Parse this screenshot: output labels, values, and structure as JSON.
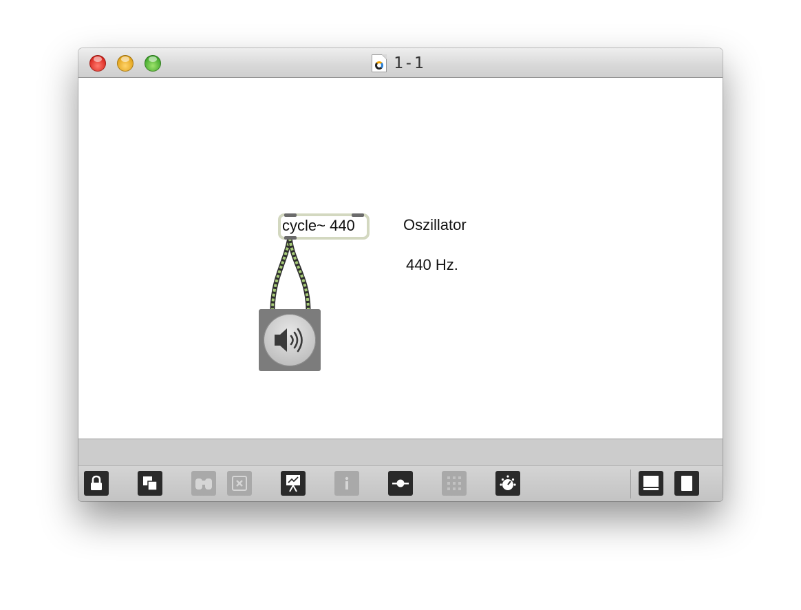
{
  "window": {
    "title": "1-1",
    "title_icon": "maxpat-document-icon",
    "traffic_lights": [
      "close",
      "minimize",
      "zoom"
    ]
  },
  "patch": {
    "object": {
      "text": "cycle~ 440",
      "inlets": 2,
      "outlets": 1
    },
    "comments": [
      {
        "text": "Oszillator"
      },
      {
        "text": "440 Hz."
      }
    ],
    "dac": {
      "icon": "speaker-icon"
    },
    "patchcord_color": "#a8cc78"
  },
  "toolbar": {
    "buttons": [
      {
        "name": "lock-icon",
        "enabled": true
      },
      {
        "name": "presentation-toggle-icon",
        "enabled": true
      },
      {
        "name": "binoculars-icon",
        "enabled": false
      },
      {
        "name": "clear-icon",
        "enabled": false
      },
      {
        "name": "presentation-board-icon",
        "enabled": true
      },
      {
        "name": "info-icon",
        "enabled": false
      },
      {
        "name": "slider-icon",
        "enabled": true
      },
      {
        "name": "grid-icon",
        "enabled": false
      },
      {
        "name": "dial-icon",
        "enabled": true
      },
      {
        "name": "bottom-panel-icon",
        "enabled": true
      },
      {
        "name": "right-panel-icon",
        "enabled": true
      }
    ]
  }
}
